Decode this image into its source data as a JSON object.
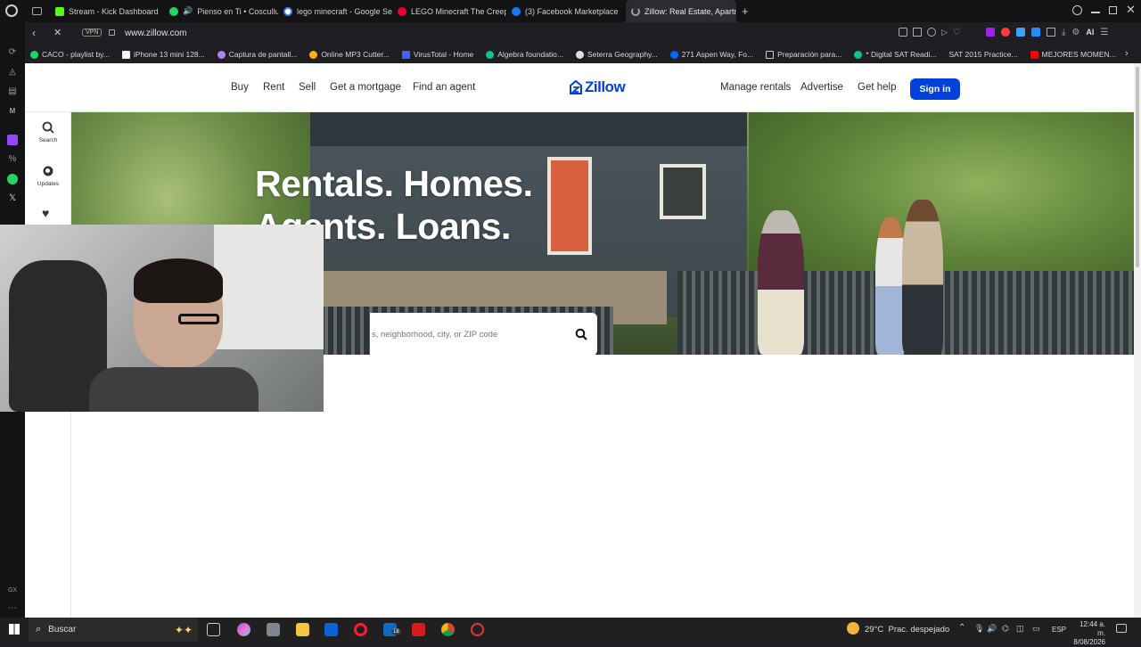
{
  "browser": {
    "tabs": [
      {
        "label": "Stream - Kick Dashboard",
        "color": "#53fc18",
        "active": false
      },
      {
        "label": "Pienso en Ti • Cosculluela",
        "color": "#1ed760",
        "active": false
      },
      {
        "label": "lego minecraft - Google Se",
        "color": "#ffffff",
        "active": false
      },
      {
        "label": "LEGO Minecraft The Creep",
        "color": "#e4002b",
        "active": false
      },
      {
        "label": "(3) Facebook Marketplace",
        "color": "#1877f2",
        "active": false
      },
      {
        "label": "Zillow: Real Estate, Apartm",
        "color": "#9aa0a6",
        "active": true
      }
    ],
    "new_tab": "+",
    "vpn_label": "VPN",
    "url": "www.zillow.com",
    "ai_label": "AI",
    "bookmarks": [
      {
        "label": "CACO - playlist by...",
        "color": "#1ed760"
      },
      {
        "label": "iPhone 13 mini 128...",
        "color": "#f5f5f5"
      },
      {
        "label": "Captura de pantall...",
        "color": "#b084f5"
      },
      {
        "label": "Online MP3 Cutter...",
        "color": "#ffb300"
      },
      {
        "label": "VirusTotal - Home",
        "color": "#3b61ff"
      },
      {
        "label": "Algebra foundatio...",
        "color": "#14bf96"
      },
      {
        "label": "Seterra Geography...",
        "color": "#e0e0e0"
      },
      {
        "label": "271 Aspen Way, Fo...",
        "color": "#006aff"
      },
      {
        "label": "Preparación para...",
        "color": "#cccccc"
      },
      {
        "label": "* Digital SAT Readi...",
        "color": "#14bf96"
      },
      {
        "label": "SAT 2015 Practice...",
        "color": "#1e1e23"
      },
      {
        "label": "MEJORES MOMEN...",
        "color": "#ff0000"
      }
    ]
  },
  "site": {
    "nav_left": [
      "Buy",
      "Rent",
      "Sell",
      "Get a mortgage",
      "Find an agent"
    ],
    "logo": "Zillow",
    "nav_right": [
      "Manage rentals",
      "Advertise",
      "Get help"
    ],
    "signin": "Sign in",
    "side": {
      "search": "Search",
      "updates": "Updates"
    },
    "hero_line1": "Rentals. Homes.",
    "hero_line2": "Agents. Loans.",
    "search_placeholder": "s, neighborhood, city, or ZIP code",
    "brand_color": "#0041d9"
  },
  "taskbar": {
    "search_label": "Buscar",
    "weather": "29°C  Prac. despejado",
    "lang": "ESP",
    "time": "12:44 a. m.",
    "date": "8/08/2026",
    "badge": "18"
  }
}
